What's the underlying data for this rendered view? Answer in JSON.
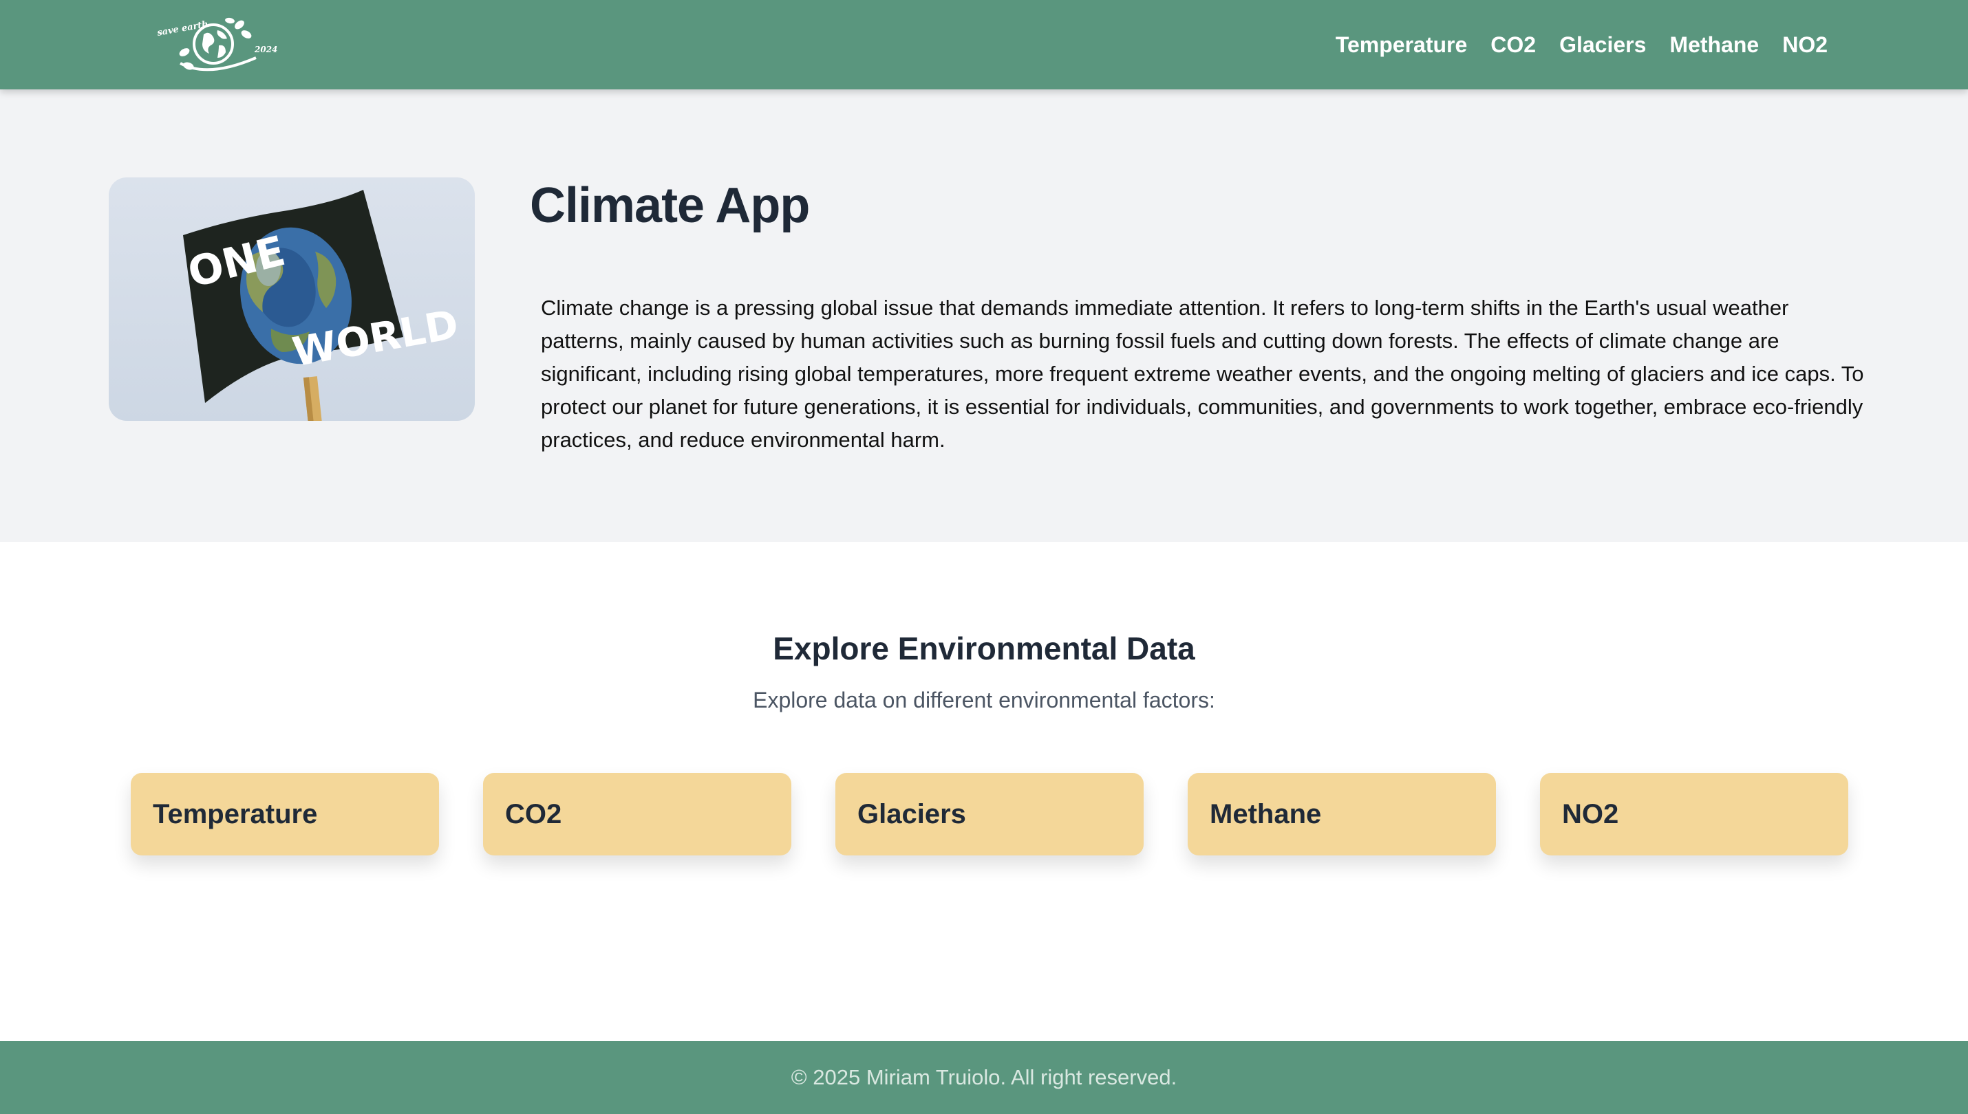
{
  "header": {
    "logo_text_top": "save earth",
    "logo_text_year": "2024",
    "nav": [
      {
        "label": "Temperature"
      },
      {
        "label": "CO2"
      },
      {
        "label": "Glaciers"
      },
      {
        "label": "Methane"
      },
      {
        "label": "NO2"
      }
    ]
  },
  "hero": {
    "sign_text_top": "ONE",
    "sign_text_bottom": "WORLD",
    "title": "Climate App",
    "description": "Climate change is a pressing global issue that demands immediate attention. It refers to long-term shifts in the Earth's usual weather patterns, mainly caused by human activities such as burning fossil fuels and cutting down forests. The effects of climate change are significant, including rising global temperatures, more frequent extreme weather events, and the ongoing melting of glaciers and ice caps. To protect our planet for future generations, it is essential for individuals, communities, and governments to work together, embrace eco-friendly practices, and reduce environmental harm."
  },
  "explore": {
    "title": "Explore Environmental Data",
    "subtitle": "Explore data on different environmental factors:",
    "cards": [
      {
        "label": "Temperature"
      },
      {
        "label": "CO2"
      },
      {
        "label": "Glaciers"
      },
      {
        "label": "Methane"
      },
      {
        "label": "NO2"
      }
    ]
  },
  "footer": {
    "copyright": "© 2025 Miriam Truiolo. All right reserved."
  },
  "colors": {
    "brand_green": "#5a967e",
    "card_yellow": "#f4d799",
    "hero_bg": "#f2f3f5"
  }
}
